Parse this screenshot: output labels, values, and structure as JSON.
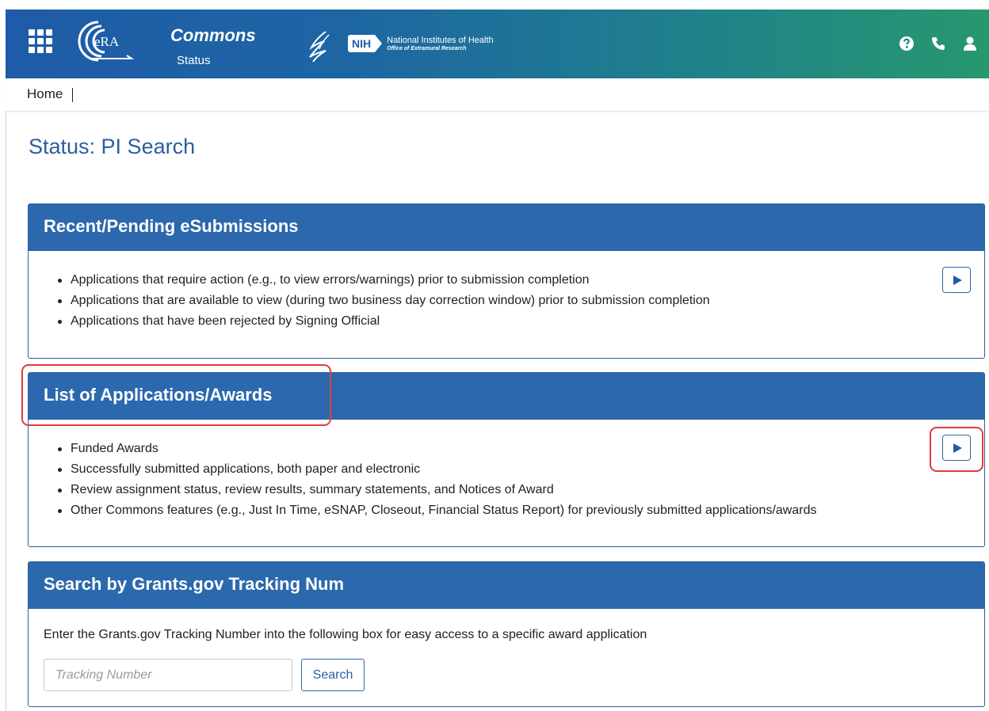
{
  "header": {
    "app_title": "Commons",
    "app_subtitle": "Status",
    "era_logo_text": "eRA",
    "nih_mark": "NIH",
    "nih_name": "National Institutes of Health",
    "nih_office": "Office of Extramural Research",
    "icons": [
      "apps-grid-icon",
      "help-icon",
      "phone-icon",
      "user-icon"
    ]
  },
  "breadcrumb": {
    "home": "Home"
  },
  "page": {
    "title": "Status: PI Search"
  },
  "panels": [
    {
      "title": "Recent/Pending eSubmissions",
      "items": [
        "Applications that require action (e.g., to view errors/warnings) prior to submission completion",
        "Applications that are available to view (during two business day correction window) prior to submission completion",
        "Applications that have been rejected by Signing Official"
      ]
    },
    {
      "title": "List of Applications/Awards",
      "items": [
        "Funded Awards",
        "Successfully submitted applications, both paper and electronic",
        "Review assignment status, review results, summary statements, and Notices of Award",
        "Other Commons features (e.g., Just In Time, eSNAP, Closeout, Financial Status Report) for previously submitted applications/awards"
      ]
    },
    {
      "title": "Search by Grants.gov Tracking Num",
      "description": "Enter the Grants.gov Tracking Number into the following box for easy access to a specific award application",
      "input_placeholder": "Tracking Number",
      "input_value": "",
      "button_label": "Search"
    }
  ],
  "colors": {
    "header_start": "#1f5ba8",
    "header_end": "#27986f",
    "panel_header": "#2c68ad",
    "title_text": "#2c5f9e",
    "highlight": "#e23b3b"
  }
}
